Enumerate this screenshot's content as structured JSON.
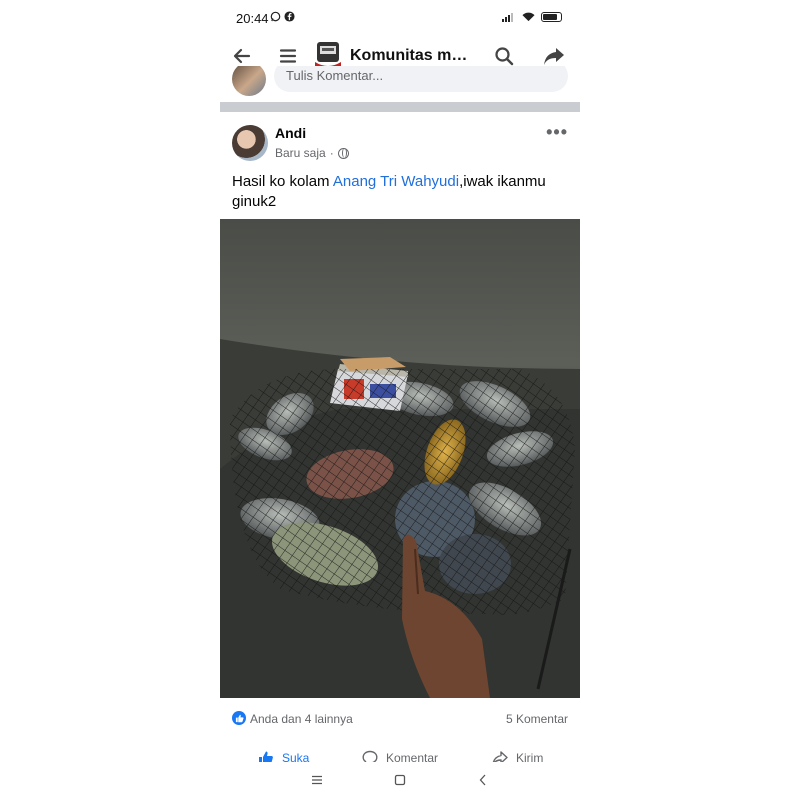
{
  "status_bar": {
    "time": "20:44",
    "left_icons": [
      "whatsapp-icon",
      "facebook-icon"
    ],
    "right_icons": [
      "signal-icon",
      "wifi-icon",
      "battery-icon"
    ]
  },
  "top_bar": {
    "title": "Komunitas man...",
    "icons": [
      "back-arrow-icon",
      "menu-icon",
      "group-thumbnail",
      "search-icon",
      "share-icon"
    ]
  },
  "comment_composer": {
    "placeholder": "Tulis Komentar..."
  },
  "post": {
    "author": "Andi",
    "time": "Baru saja",
    "privacy_icon": "globe-icon",
    "text_before": "Hasil ko kolam ",
    "mention": "Anang Tri Wahyudi",
    "text_after": ",iwak ikanmu ginuk2",
    "photo_description_icon": "fish-catch-photo",
    "reactions_text": "Anda dan 4 lainnya",
    "comments_text": "5 Komentar",
    "actions": [
      {
        "label": "Suka",
        "icon": "like-icon"
      },
      {
        "label": "Komentar",
        "icon": "comment-icon"
      },
      {
        "label": "Kirim",
        "icon": "send-icon"
      }
    ]
  },
  "colors": {
    "accent": "#1877f2",
    "mention": "#216fdb",
    "divider": "#c9ccd1",
    "muted_text": "#65676b"
  }
}
